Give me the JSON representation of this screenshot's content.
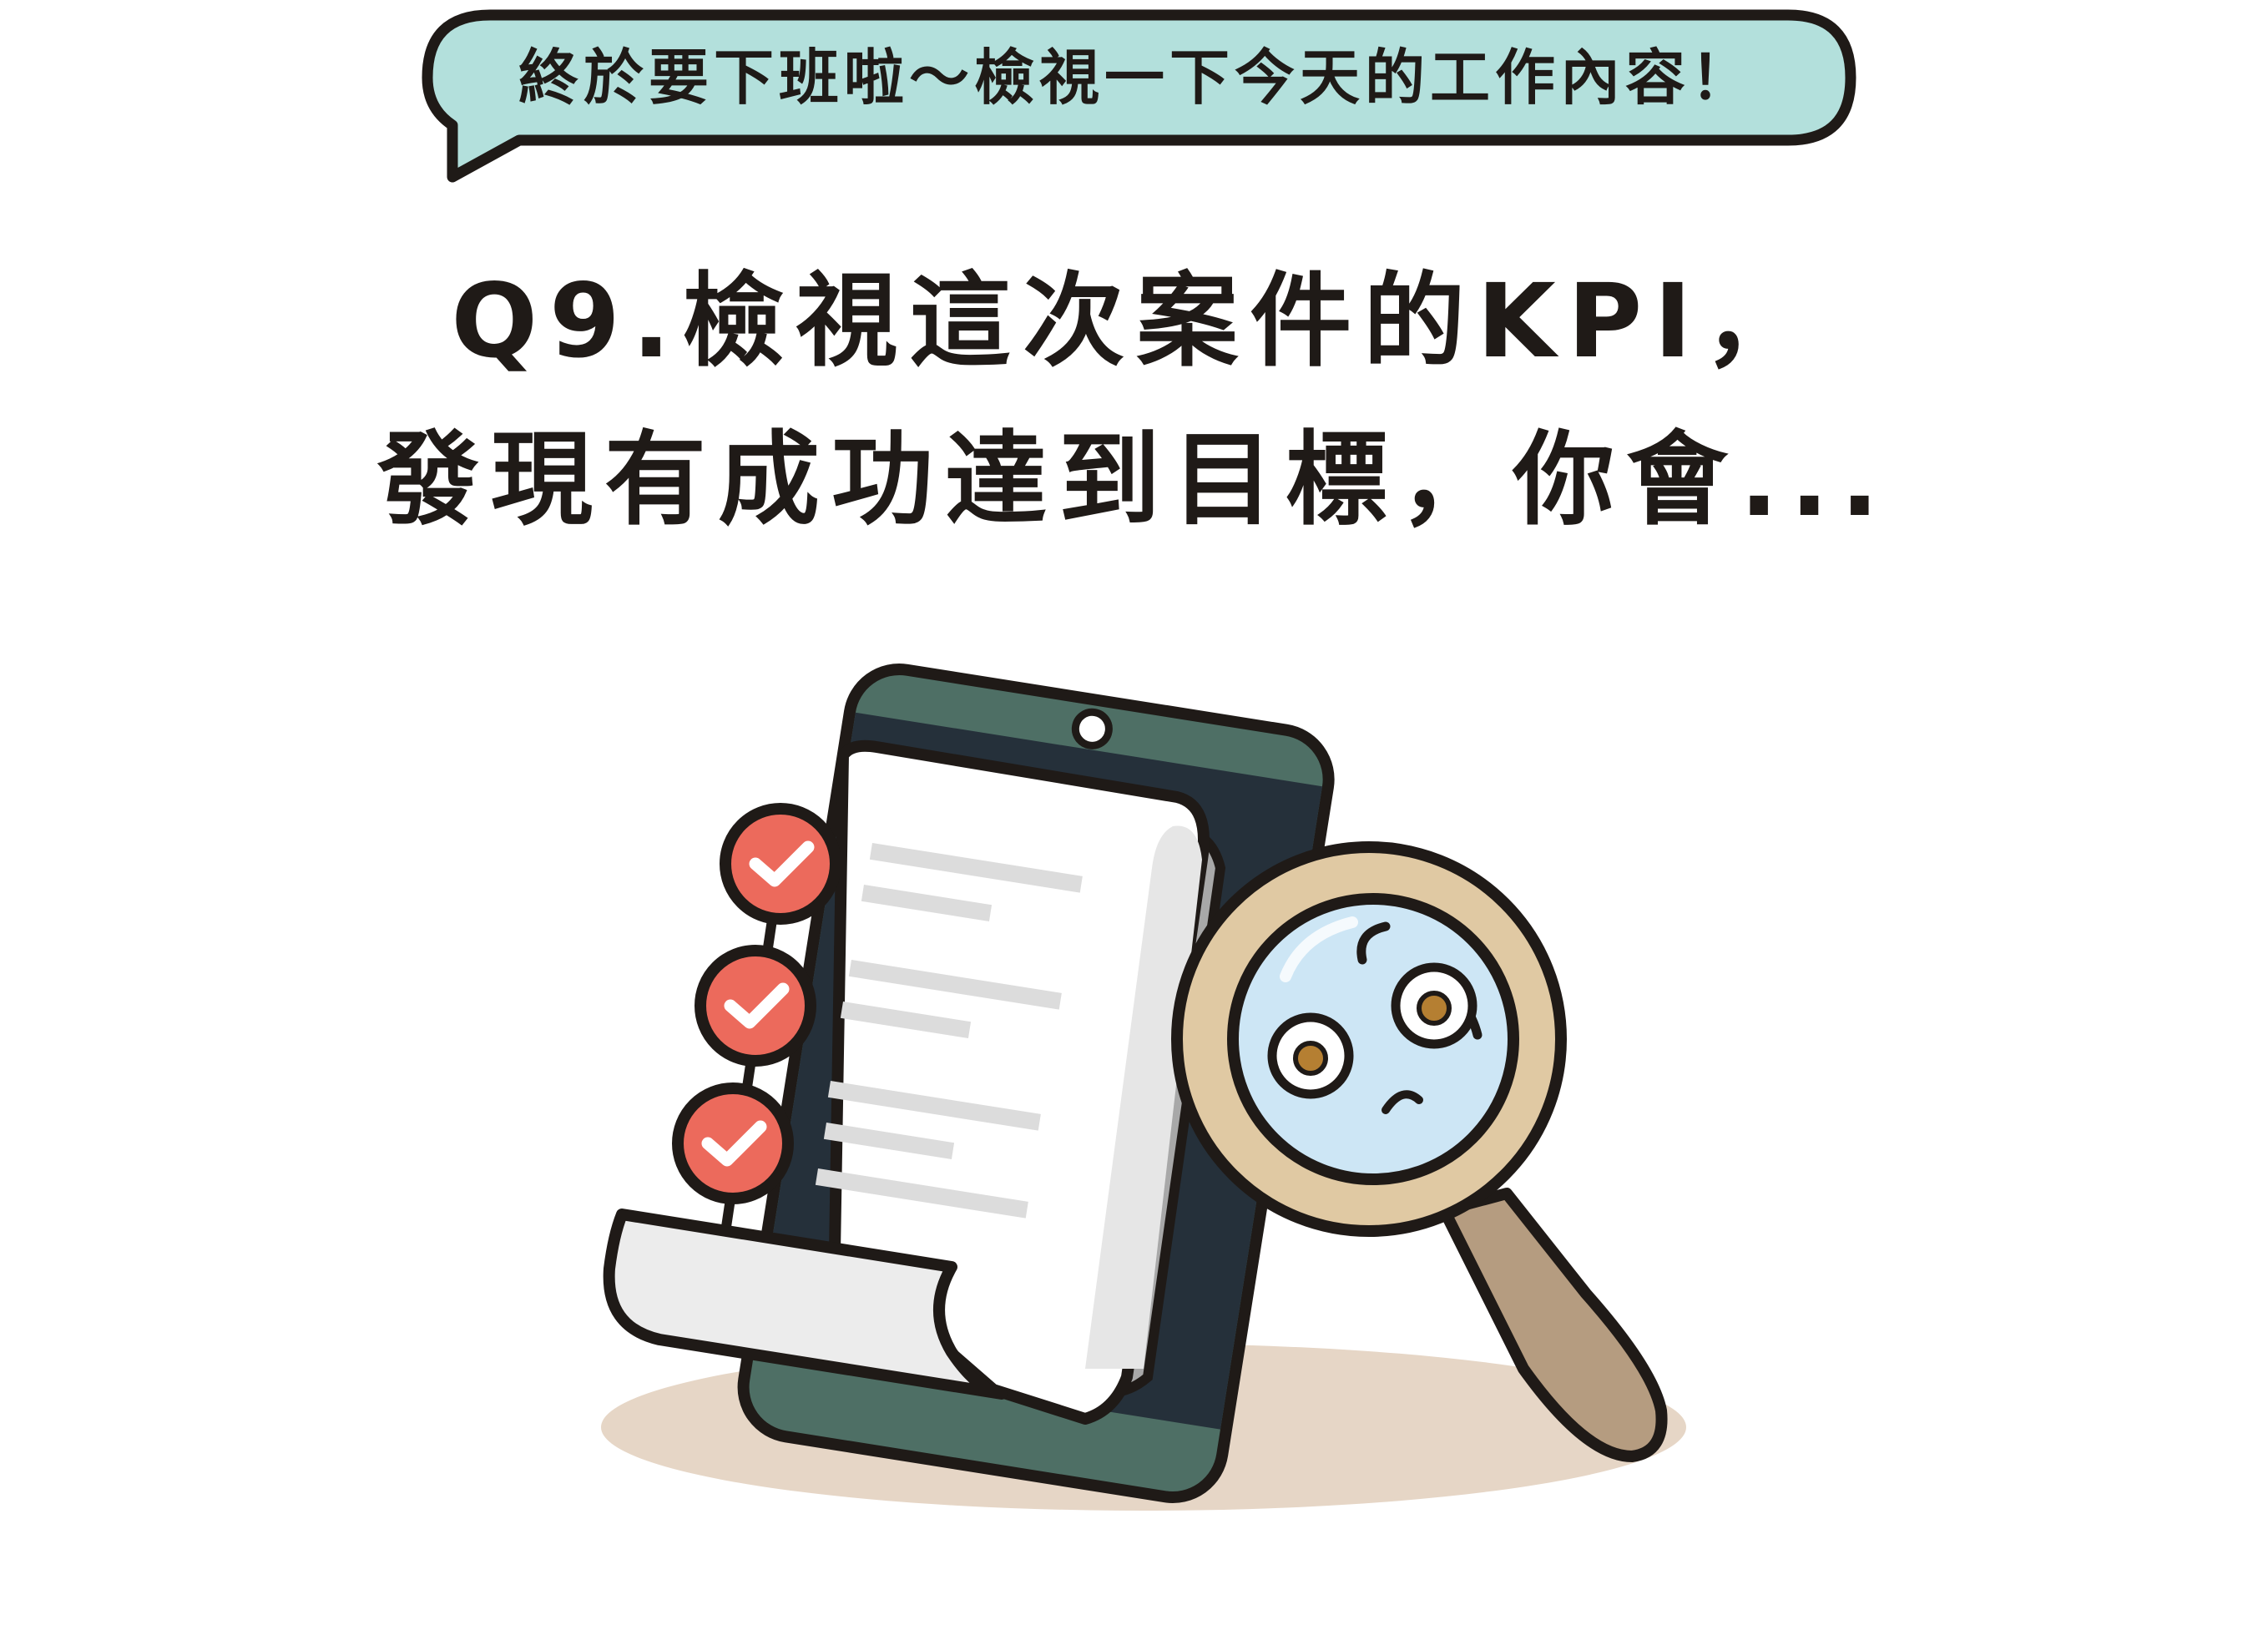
{
  "bubble": {
    "text": "終於要下班啦～檢視一下今天的工作內容！",
    "color": "#b3e0dc"
  },
  "question": {
    "line1": "Q9.檢視這次案件的KPI，",
    "line2": "發現有成功達到目標，你會..."
  },
  "colors": {
    "ink": "#1f1a17",
    "phone_body": "#4e6f65",
    "phone_screen": "#25303a",
    "check_red": "#ec6a5c",
    "magnifier_rim": "#e0c9a3",
    "magnifier_glass": "#cde6f5",
    "handle": "#b59c80",
    "shadow": "#e6d6c6"
  },
  "icons": [
    "speech-bubble-icon",
    "phone-icon",
    "checklist-icon",
    "check-icon",
    "magnifying-glass-icon"
  ]
}
